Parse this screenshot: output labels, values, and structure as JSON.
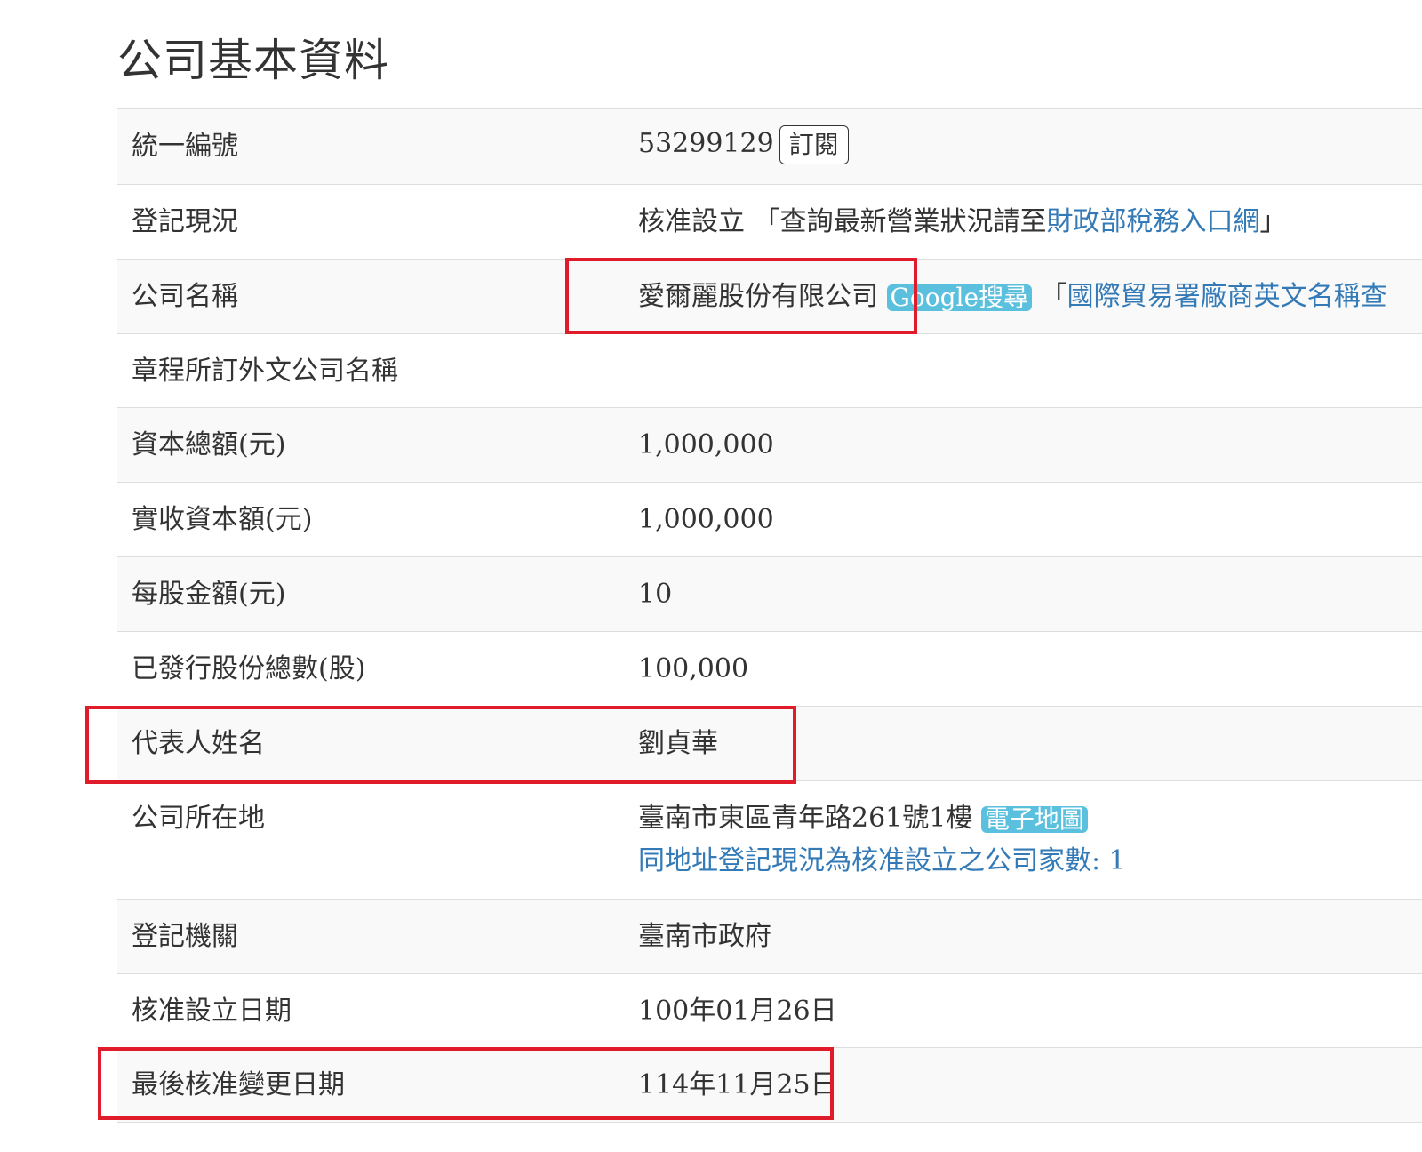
{
  "page_title": "公司基本資料",
  "subscribe_button": "訂閱",
  "rows": {
    "uniform_number": {
      "label": "統一編號",
      "value": "53299129"
    },
    "registration_status": {
      "label": "登記現況",
      "value": "核准設立",
      "prefix": "「查詢最新營業狀況請至",
      "link": "財政部稅務入口網",
      "suffix": "」"
    },
    "company_name": {
      "label": "公司名稱",
      "value": "愛爾麗股份有限公司",
      "google_badge": "Google搜尋",
      "trade_prefix": "「",
      "trade_link": "國際貿易署廠商英文名稱查"
    },
    "foreign_name": {
      "label": "章程所訂外文公司名稱",
      "value": ""
    },
    "capital_total": {
      "label": "資本總額(元)",
      "value": "1,000,000"
    },
    "paid_in_capital": {
      "label": "實收資本額(元)",
      "value": "1,000,000"
    },
    "par_value": {
      "label": "每股金額(元)",
      "value": "10"
    },
    "shares_issued": {
      "label": "已發行股份總數(股)",
      "value": "100,000"
    },
    "representative": {
      "label": "代表人姓名",
      "value": "劉貞華"
    },
    "address": {
      "label": "公司所在地",
      "value": "臺南市東區青年路261號1樓",
      "map_badge": "電子地圖",
      "same_address_link": "同地址登記現況為核准設立之公司家數: 1"
    },
    "registration_authority": {
      "label": "登記機關",
      "value": "臺南市政府"
    },
    "approval_date": {
      "label": "核准設立日期",
      "value": "100年01月26日"
    },
    "last_change_date": {
      "label": "最後核准變更日期",
      "value": "114年11月25日"
    }
  }
}
